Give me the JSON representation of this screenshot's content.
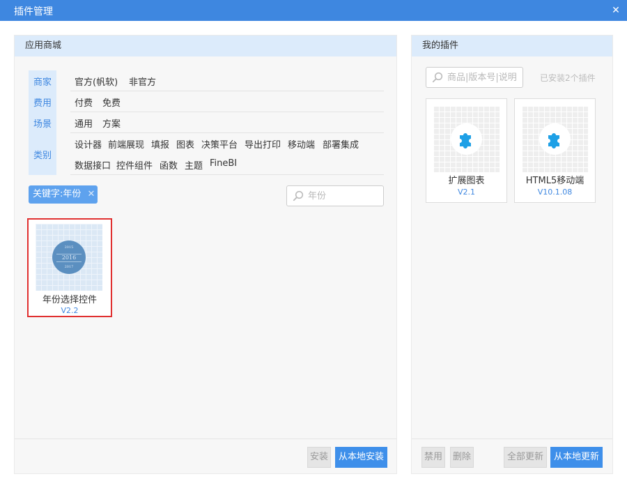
{
  "window": {
    "title": "插件管理",
    "close_glyph": "✕"
  },
  "left_panel": {
    "title": "应用商城",
    "filters": {
      "merchant": {
        "label": "商家",
        "options": [
          "官方(帆软)",
          "非官方"
        ]
      },
      "fee": {
        "label": "费用",
        "options": [
          "付费",
          "免费"
        ]
      },
      "scene": {
        "label": "场景",
        "options": [
          "通用",
          "方案"
        ]
      },
      "category": {
        "label": "类别",
        "options_row1": [
          "设计器",
          "前端展现",
          "填报",
          "图表",
          "决策平台",
          "导出打印",
          "移动端",
          "部署集成"
        ],
        "options_row2": [
          "数据接口",
          "控件组件",
          "函数",
          "主题",
          "FineBI"
        ]
      }
    },
    "keyword_tag": {
      "label": "关键字:年份",
      "remove_glyph": "✕"
    },
    "search": {
      "placeholder": "年份",
      "value": "",
      "icon": "search-icon"
    },
    "results": [
      {
        "name": "年份选择控件",
        "version": "V2.2",
        "years": [
          "2015",
          "2016",
          "2017"
        ],
        "selected": true
      }
    ],
    "buttons": {
      "install": "安装",
      "install_local": "从本地安装"
    }
  },
  "right_panel": {
    "title": "我的插件",
    "search": {
      "placeholder": "商品|版本号|说明",
      "value": "",
      "icon": "search-icon"
    },
    "installed_count_text": "已安装2个插件",
    "plugins": [
      {
        "name": "扩展图表",
        "version": "V2.1",
        "icon": "puzzle-icon"
      },
      {
        "name": "HTML5移动端",
        "version": "V10.1.08",
        "icon": "puzzle-icon"
      }
    ],
    "buttons": {
      "disable": "禁用",
      "delete": "删除",
      "update_all": "全部更新",
      "update_local": "从本地更新"
    }
  },
  "colors": {
    "accent": "#3e87e0",
    "header_bg": "#dcebfb",
    "selection_border": "#e03030",
    "puzzle": "#1ea0e6"
  }
}
